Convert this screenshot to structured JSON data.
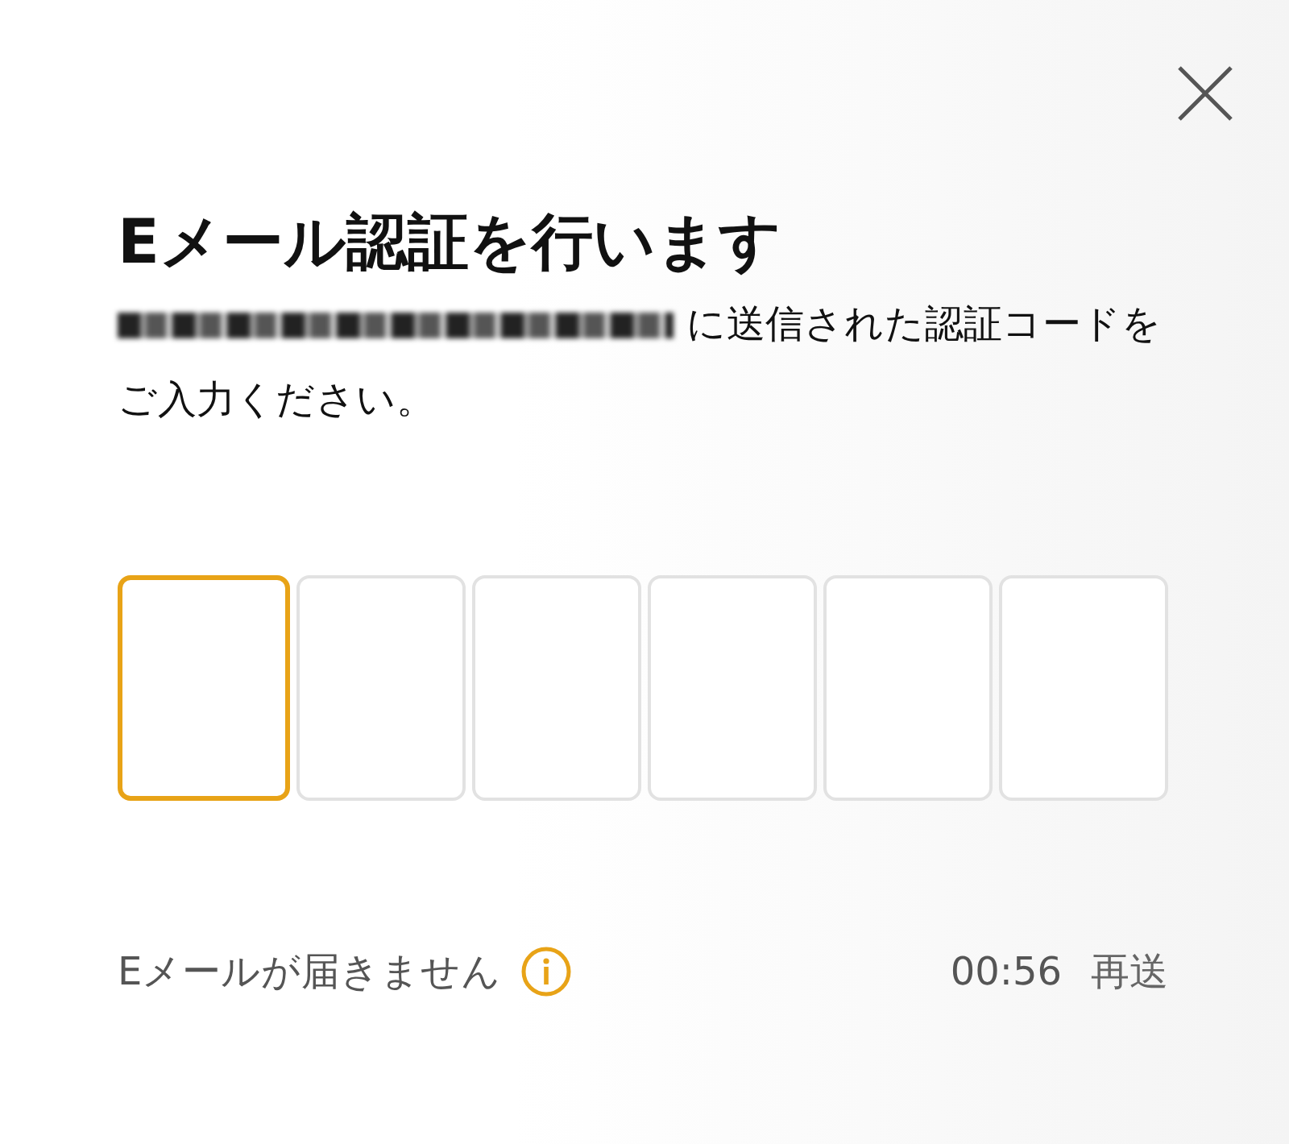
{
  "title": "Eメール認証を行います",
  "message": "に送信された認証コードをご入力ください。",
  "code_boxes": [
    {
      "selected": true
    },
    {
      "selected": false
    },
    {
      "selected": false
    },
    {
      "selected": false
    },
    {
      "selected": false
    },
    {
      "selected": false
    }
  ],
  "footer": {
    "help_text": "Eメールが届きません",
    "timer": "00:56",
    "resend": "再送"
  }
}
